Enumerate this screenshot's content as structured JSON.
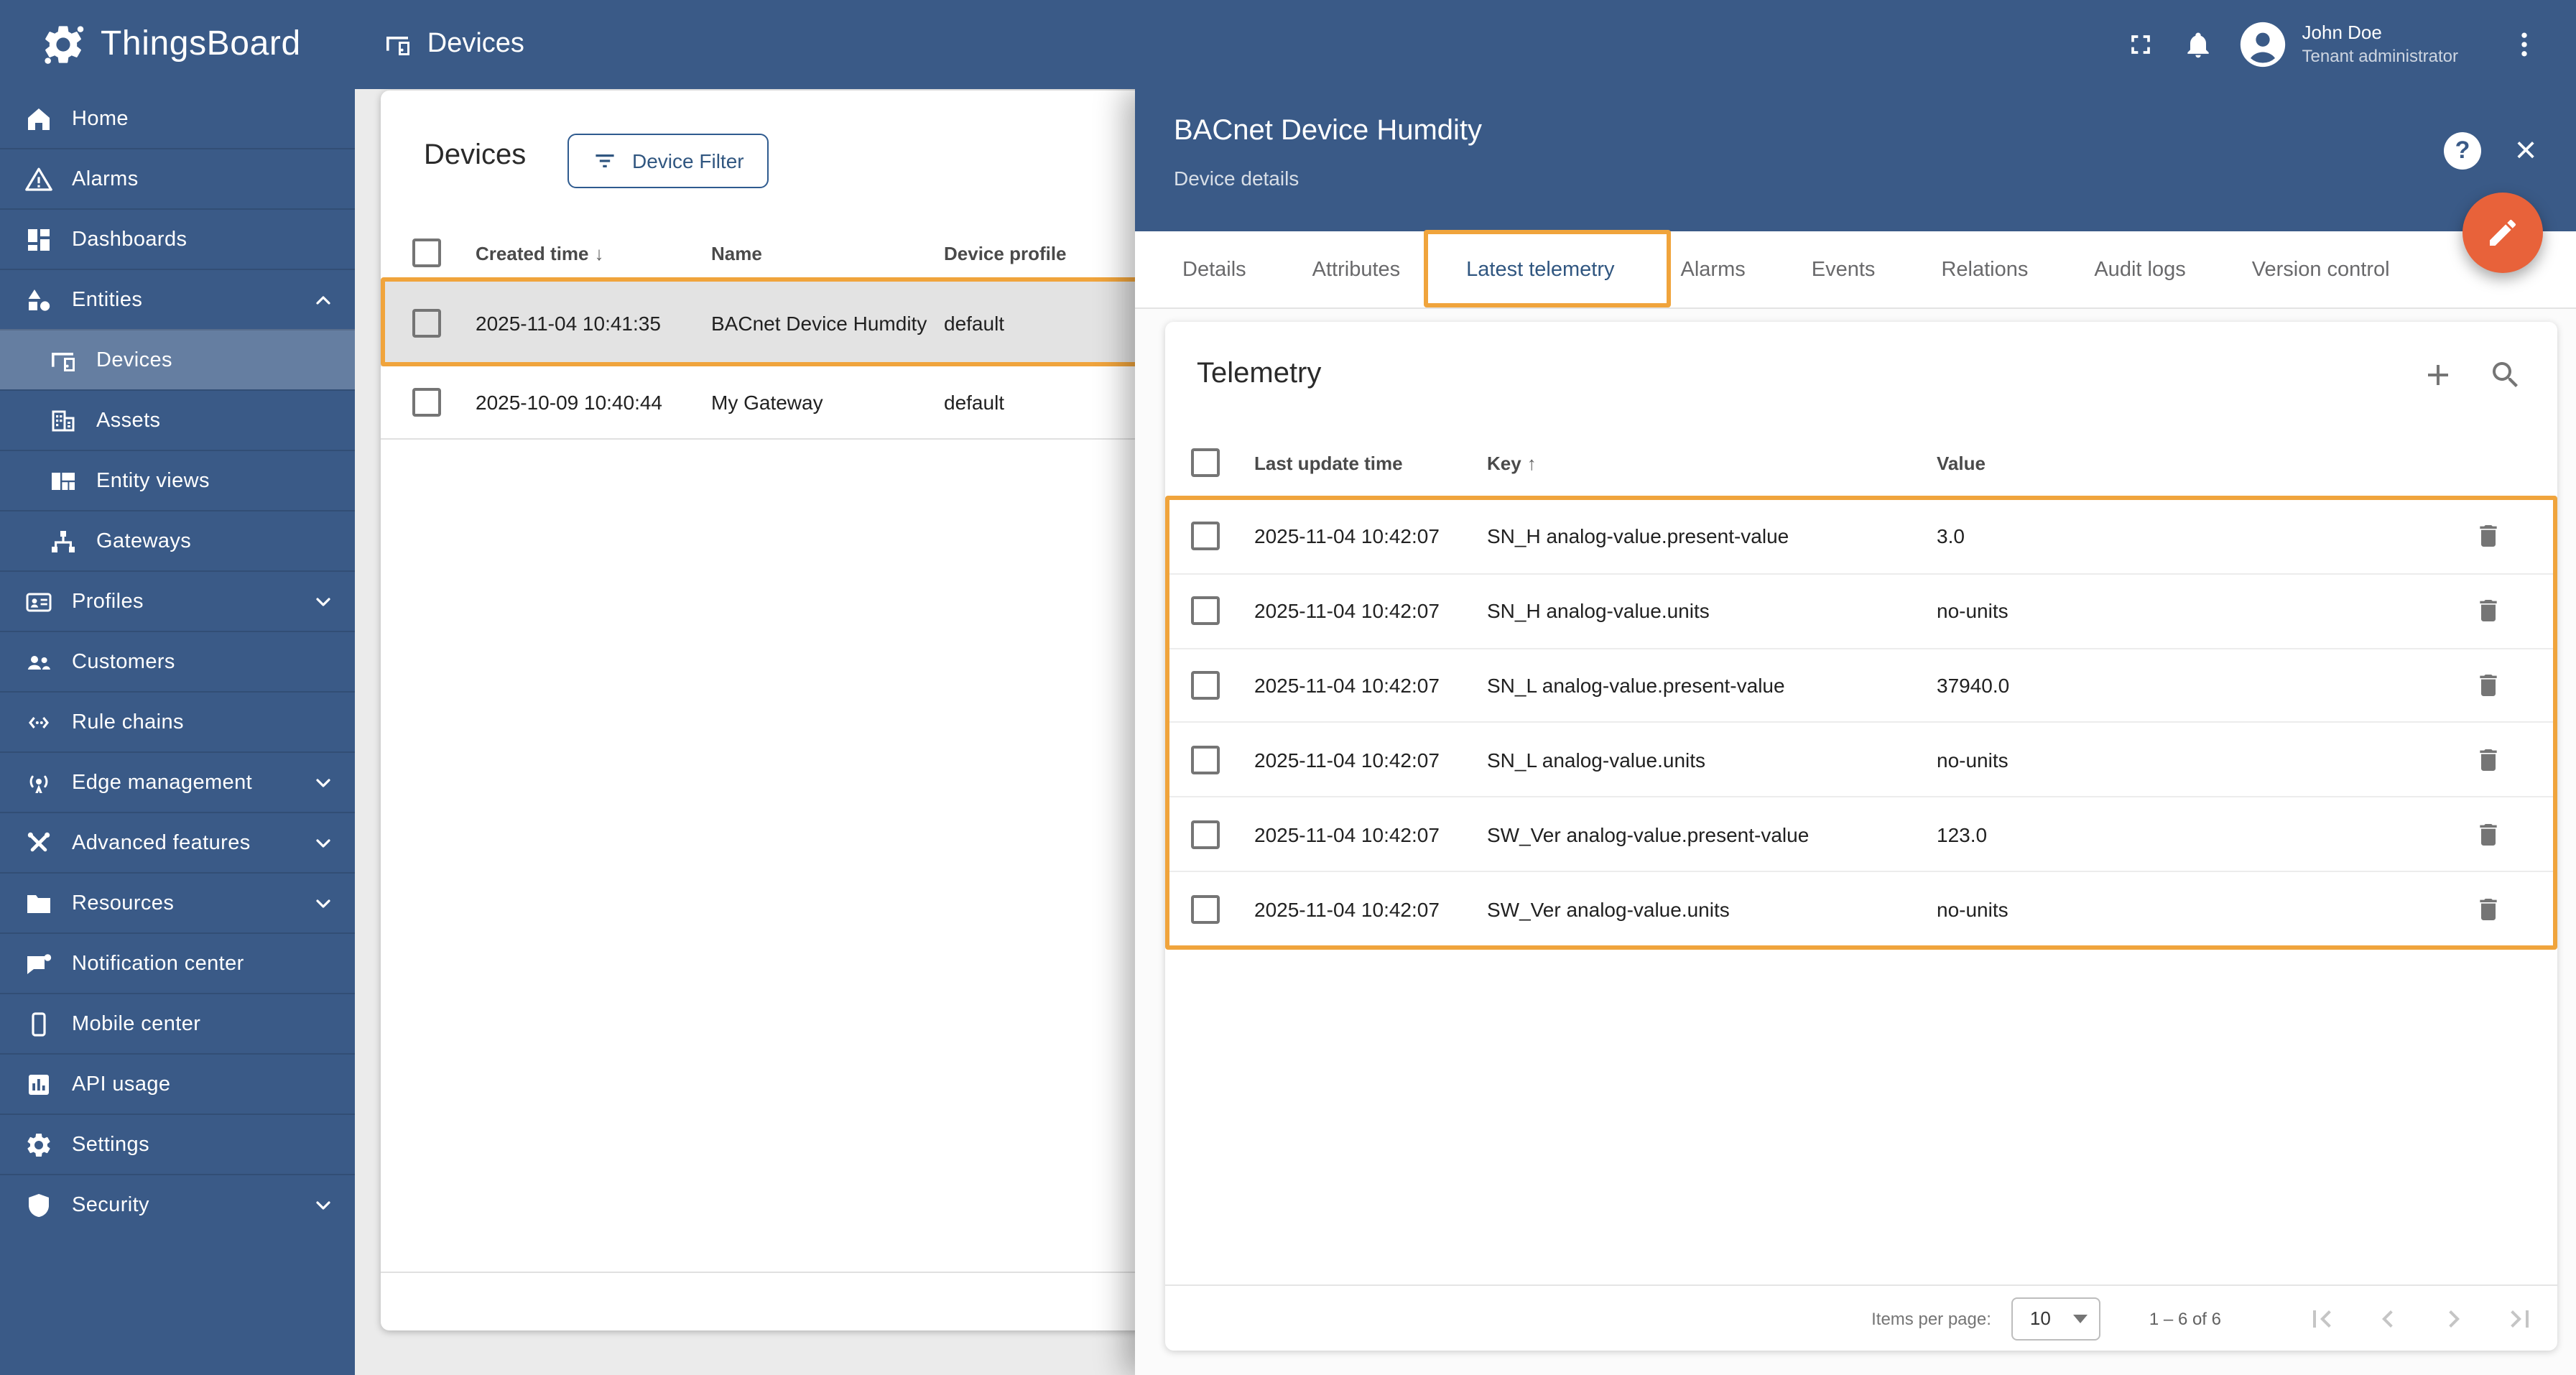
{
  "app": {
    "brand": "ThingsBoard",
    "page_title": "Devices"
  },
  "topbar": {
    "user": {
      "name": "John Doe",
      "role": "Tenant administrator"
    },
    "icons": [
      "fullscreen-icon",
      "notifications-bell-icon",
      "avatar",
      "more-vert-icon"
    ]
  },
  "sidebar": {
    "items": [
      {
        "label": "Home",
        "icon": "home-icon"
      },
      {
        "label": "Alarms",
        "icon": "alarms-icon"
      },
      {
        "label": "Dashboards",
        "icon": "dashboards-icon"
      },
      {
        "label": "Entities",
        "icon": "entities-icon",
        "expandable": true,
        "expanded": true
      },
      {
        "label": "Devices",
        "icon": "devices-icon",
        "sub": true,
        "selected": true
      },
      {
        "label": "Assets",
        "icon": "assets-icon",
        "sub": true
      },
      {
        "label": "Entity views",
        "icon": "entity-views-icon",
        "sub": true
      },
      {
        "label": "Gateways",
        "icon": "gateways-icon",
        "sub": true
      },
      {
        "label": "Profiles",
        "icon": "profiles-icon",
        "expandable": true
      },
      {
        "label": "Customers",
        "icon": "customers-icon"
      },
      {
        "label": "Rule chains",
        "icon": "rule-chains-icon"
      },
      {
        "label": "Edge management",
        "icon": "edge-management-icon",
        "expandable": true
      },
      {
        "label": "Advanced features",
        "icon": "advanced-features-icon",
        "expandable": true
      },
      {
        "label": "Resources",
        "icon": "resources-icon",
        "expandable": true
      },
      {
        "label": "Notification center",
        "icon": "notification-center-icon"
      },
      {
        "label": "Mobile center",
        "icon": "mobile-center-icon"
      },
      {
        "label": "API usage",
        "icon": "api-usage-icon"
      },
      {
        "label": "Settings",
        "icon": "settings-icon"
      },
      {
        "label": "Security",
        "icon": "security-icon",
        "expandable": true
      }
    ]
  },
  "devices_panel": {
    "title": "Devices",
    "filter_button_label": "Device Filter",
    "columns": {
      "created": "Created time",
      "name": "Name",
      "profile": "Device profile"
    },
    "sort": {
      "column": "Created time",
      "direction": "desc",
      "arrow": "↓"
    },
    "rows": [
      {
        "created": "2025-11-04 10:41:35",
        "name": "BACnet Device Humdity",
        "profile": "default",
        "selected": true
      },
      {
        "created": "2025-10-09 10:40:44",
        "name": "My Gateway",
        "profile": "default",
        "selected": false
      }
    ]
  },
  "details_panel": {
    "title": "BACnet Device Humdity",
    "subtitle": "Device details",
    "help_glyph": "?",
    "close_glyph": "×",
    "tabs": [
      "Details",
      "Attributes",
      "Latest telemetry",
      "Alarms",
      "Events",
      "Relations",
      "Audit logs",
      "Version control"
    ],
    "active_tab": "Latest telemetry",
    "telemetry": {
      "title": "Telemetry",
      "columns": {
        "time": "Last update time",
        "key": "Key",
        "value": "Value"
      },
      "sort": {
        "column": "Key",
        "direction": "asc",
        "arrow": "↑"
      },
      "rows": [
        {
          "time": "2025-11-04 10:42:07",
          "key": "SN_H analog-value.present-value",
          "value": "3.0"
        },
        {
          "time": "2025-11-04 10:42:07",
          "key": "SN_H analog-value.units",
          "value": "no-units"
        },
        {
          "time": "2025-11-04 10:42:07",
          "key": "SN_L analog-value.present-value",
          "value": "37940.0"
        },
        {
          "time": "2025-11-04 10:42:07",
          "key": "SN_L analog-value.units",
          "value": "no-units"
        },
        {
          "time": "2025-11-04 10:42:07",
          "key": "SW_Ver analog-value.present-value",
          "value": "123.0"
        },
        {
          "time": "2025-11-04 10:42:07",
          "key": "SW_Ver analog-value.units",
          "value": "no-units"
        }
      ]
    },
    "pagination": {
      "items_per_page_label": "Items per page:",
      "items_per_page": "10",
      "range": "1 – 6 of 6"
    }
  },
  "colors": {
    "primary": "#3a5a87",
    "active_link": "#305680",
    "fab_orange": "#e8623a",
    "annotation_orange": "#f0a43c",
    "selected_row_bg": "#e3e3e3",
    "page_bg": "#ebebeb"
  }
}
